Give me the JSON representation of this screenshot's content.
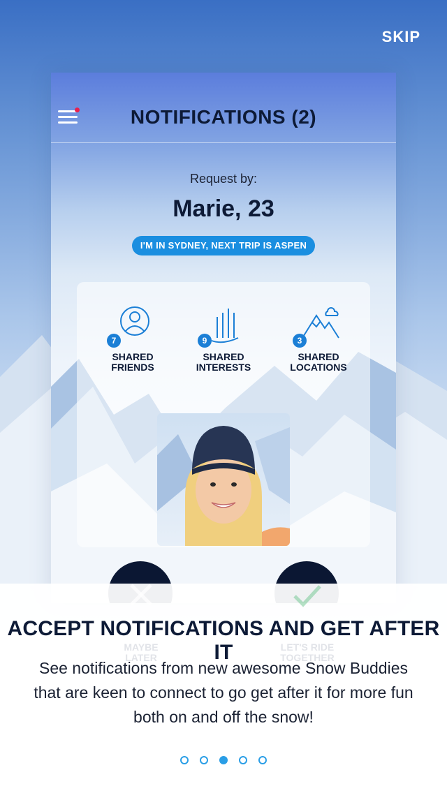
{
  "skip_label": "SKIP",
  "app": {
    "title": "NOTIFICATIONS (2)",
    "request_by_label": "Request by:",
    "requester_name": "Marie, 23",
    "location_pill": "I'M IN SYDNEY, NEXT TRIP IS ASPEN",
    "stats": [
      {
        "count": "7",
        "label_line1": "SHARED",
        "label_line2": "FRIENDS",
        "icon": "person-icon"
      },
      {
        "count": "9",
        "label_line1": "SHARED",
        "label_line2": "INTERESTS",
        "icon": "skis-icon"
      },
      {
        "count": "3",
        "label_line1": "SHARED",
        "label_line2": "LOCATIONS",
        "icon": "mountain-icon"
      }
    ],
    "actions": {
      "decline_line1": "MAYBE",
      "decline_line2": "LATER",
      "accept_line1": "LET'S RIDE",
      "accept_line2": "TOGETHER"
    }
  },
  "onboarding": {
    "heading": "ACCEPT NOTIFICATIONS AND GET AFTER IT",
    "body": "See notifications from new awesome Snow Buddies that are keen to connect to go get after it for more fun both on and off the snow!",
    "pages_total": 5,
    "active_page": 3
  },
  "colors": {
    "accent": "#1a8ee0",
    "dark_navy": "#0d1a36",
    "notification_dot": "#e8204f"
  }
}
